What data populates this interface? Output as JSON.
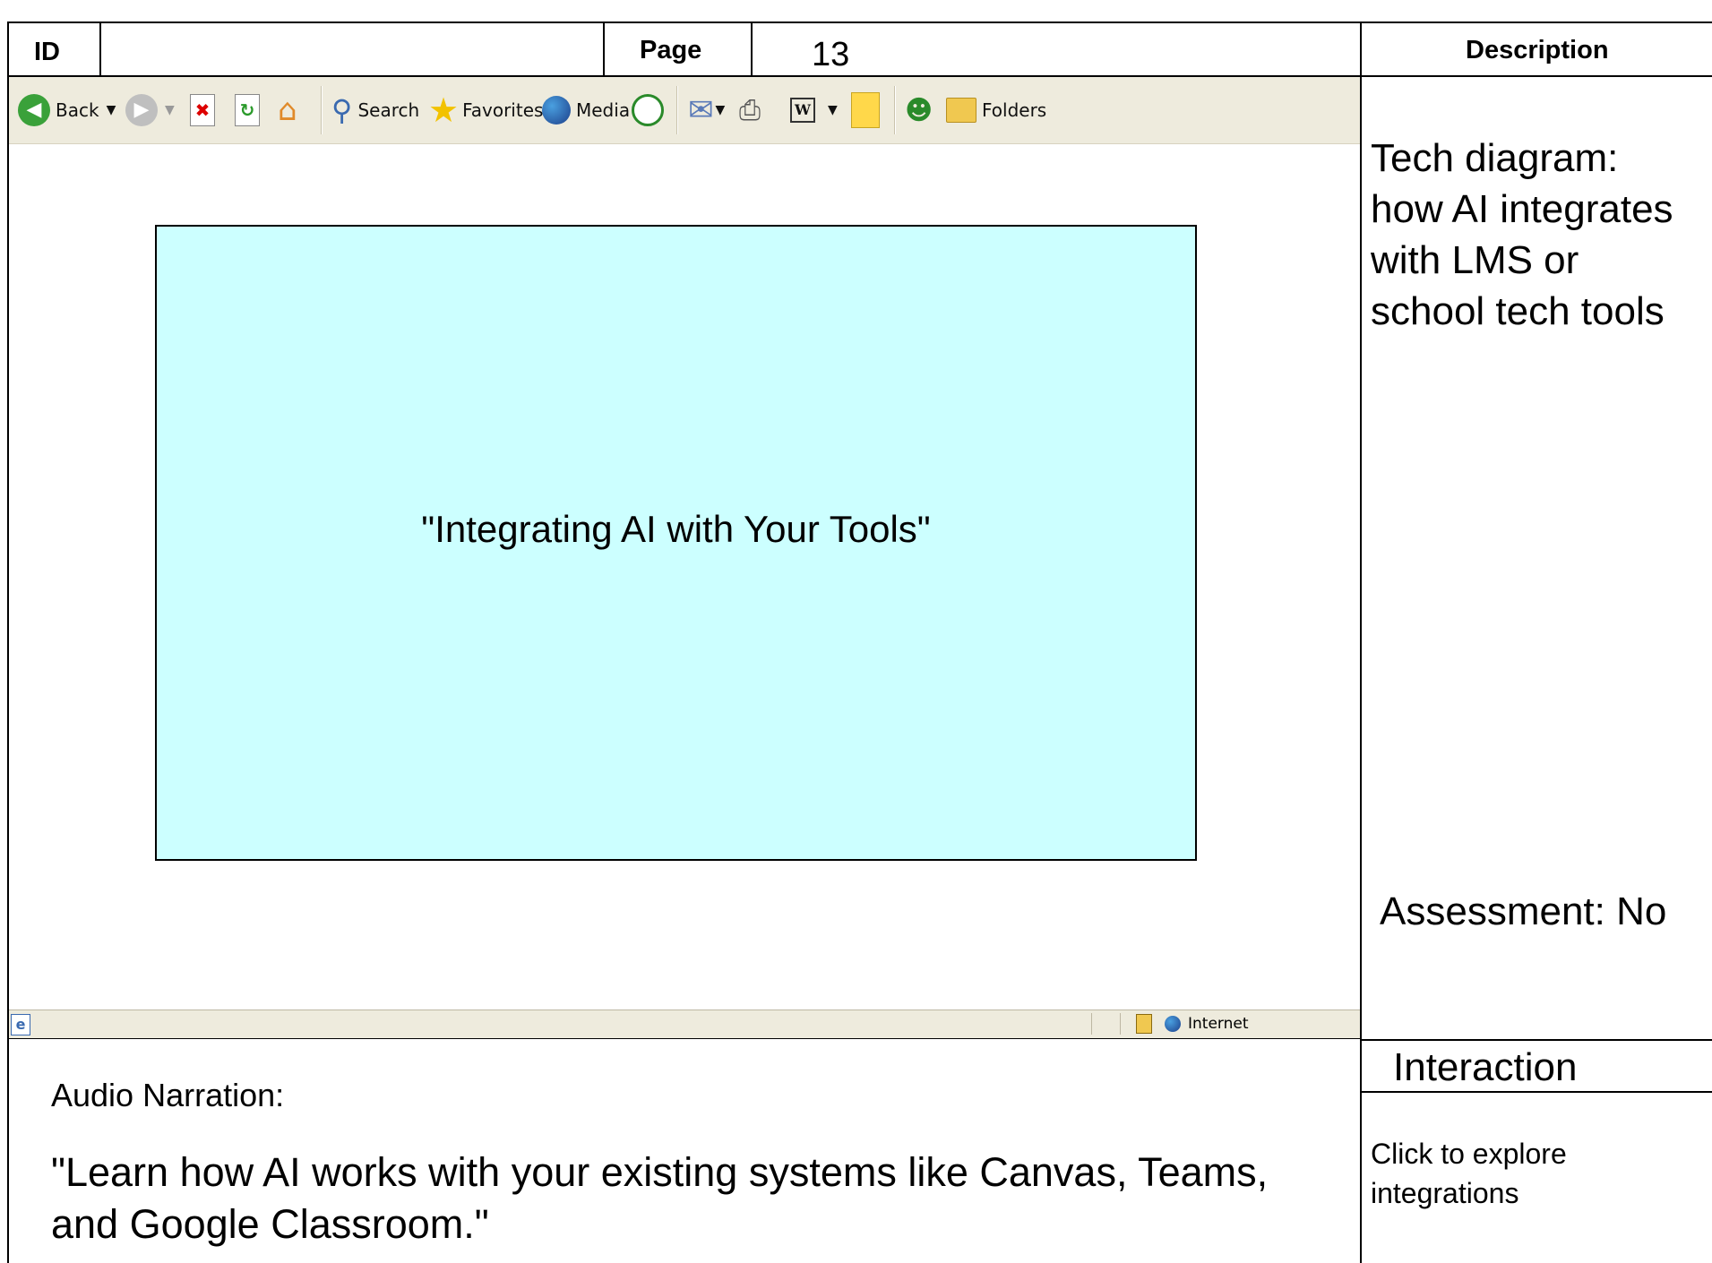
{
  "header": {
    "id_label": "ID",
    "id_value": "",
    "page_label": "Page",
    "page_value": "13",
    "description_label": "Description"
  },
  "toolbar": {
    "back_label": "Back",
    "search_label": "Search",
    "favorites_label": "Favorites",
    "media_label": "Media",
    "folders_label": "Folders"
  },
  "status": {
    "zone_label": "Internet"
  },
  "slide": {
    "title": "\"Integrating AI with Your Tools\"",
    "background": "#ccffff"
  },
  "description": {
    "text": "Tech diagram: how AI integrates with LMS or school tech tools"
  },
  "assessment": {
    "text": "Assessment: No"
  },
  "interaction": {
    "label": "Interaction",
    "text": "Click to explore integrations"
  },
  "audio": {
    "label": "Audio Narration:",
    "text": "\"Learn how AI works with your existing systems like Canvas, Teams, and Google Classroom.\""
  }
}
